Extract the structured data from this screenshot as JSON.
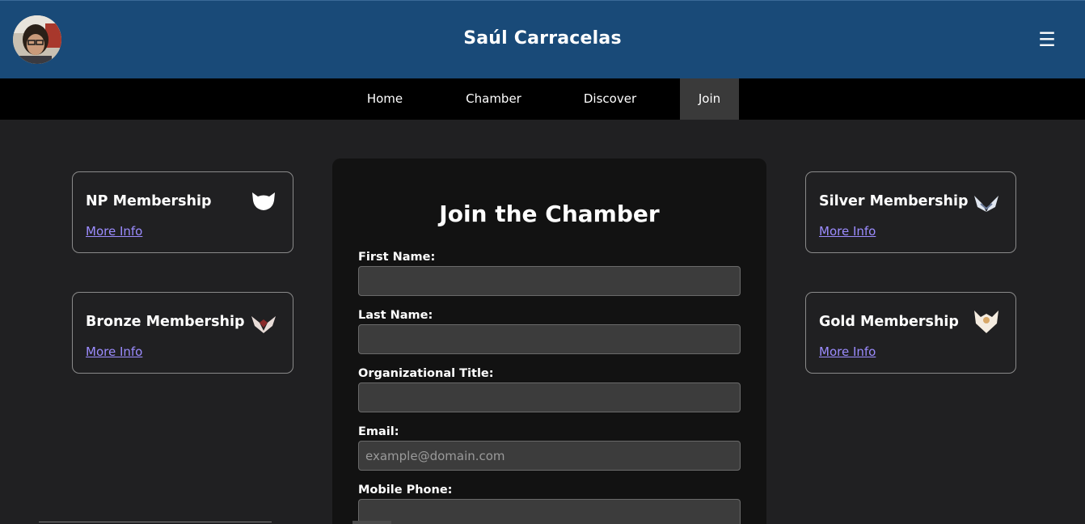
{
  "header": {
    "title": "Saúl Carracelas",
    "menu_icon": "☰",
    "accent": "#194a78"
  },
  "nav": {
    "items": [
      {
        "label": "Home"
      },
      {
        "label": "Chamber"
      },
      {
        "label": "Discover"
      },
      {
        "label": "Join"
      }
    ],
    "active": "Join"
  },
  "memberships": [
    {
      "title": "NP Membership",
      "link": "More Info",
      "icon": "np-badge-icon"
    },
    {
      "title": "Bronze Membership",
      "link": "More Info",
      "icon": "bronze-wings-icon"
    },
    {
      "title": "Silver Membership",
      "link": "More Info",
      "icon": "silver-wings-icon"
    },
    {
      "title": "Gold Membership",
      "link": "More Info",
      "icon": "gold-eagle-icon"
    }
  ],
  "form": {
    "title": "Join the Chamber",
    "fields": [
      {
        "label": "First Name:",
        "value": "",
        "placeholder": ""
      },
      {
        "label": "Last Name:",
        "value": "",
        "placeholder": ""
      },
      {
        "label": "Organizational Title:",
        "value": "",
        "placeholder": ""
      },
      {
        "label": "Email:",
        "value": "",
        "placeholder": "example@domain.com"
      },
      {
        "label": "Mobile Phone:",
        "value": "",
        "placeholder": ""
      }
    ]
  },
  "colors": {
    "link": "#9c8cff",
    "background": "#202022",
    "panel": "#121212"
  }
}
